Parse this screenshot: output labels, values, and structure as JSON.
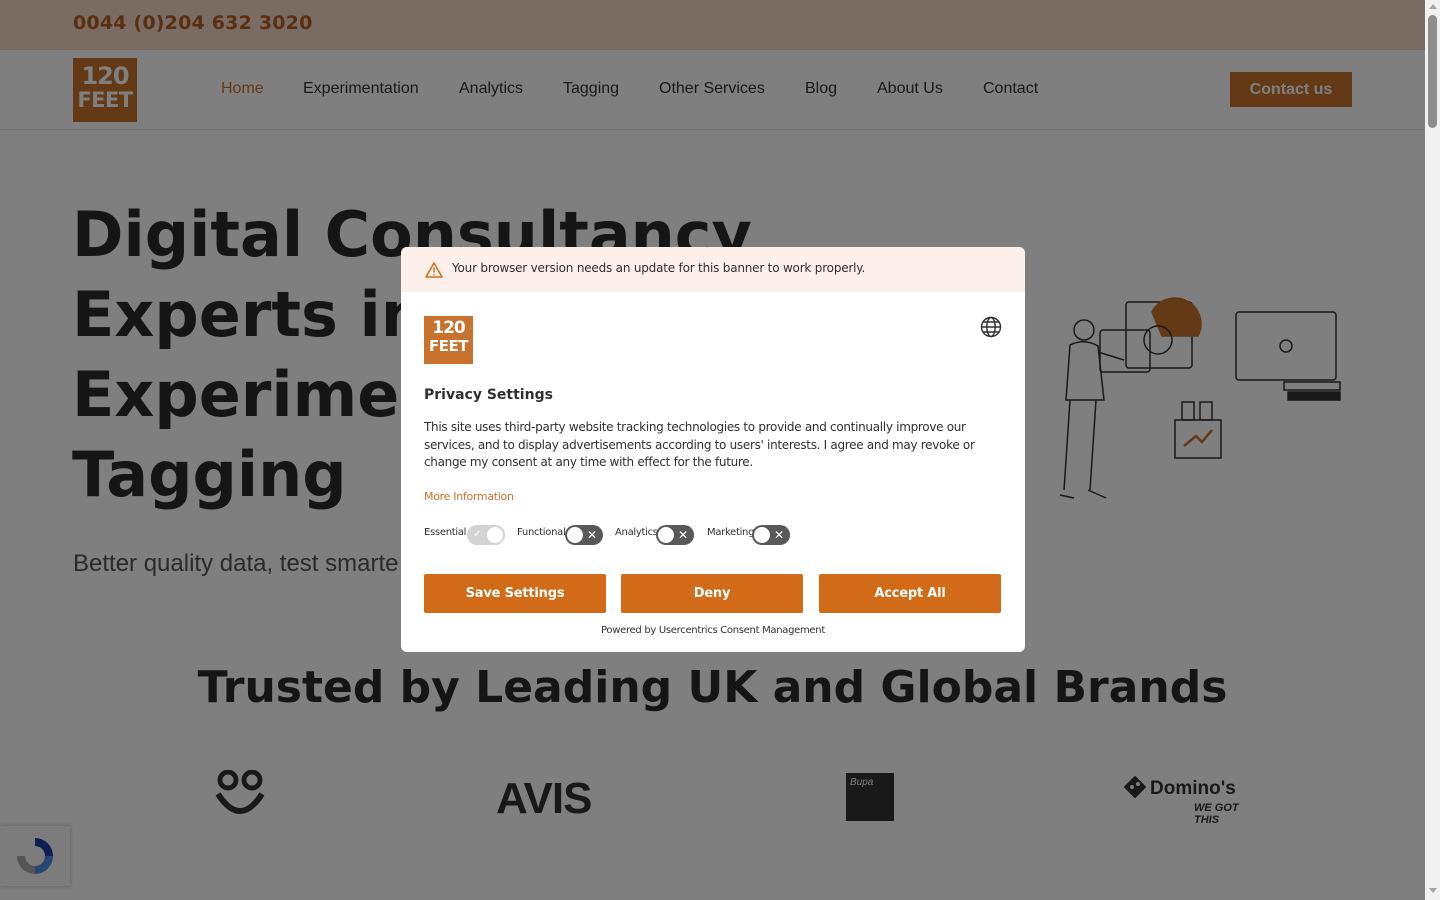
{
  "topbar": {
    "phone": "0044 (0)204 632 3020"
  },
  "header": {
    "logo_line1": "120",
    "logo_line2": "FEET",
    "nav": [
      {
        "label": "Home",
        "active": true
      },
      {
        "label": "Experimentation"
      },
      {
        "label": "Analytics"
      },
      {
        "label": "Tagging"
      },
      {
        "label": "Other Services"
      },
      {
        "label": "Blog"
      },
      {
        "label": "About Us"
      },
      {
        "label": "Contact"
      }
    ],
    "cta": "Contact us"
  },
  "hero": {
    "title_lines": [
      "Digital Consultancy",
      "Experts in",
      "Experiment",
      "Tagging"
    ],
    "subtitle": "Better quality data, test smarte"
  },
  "trusted": {
    "heading": "Trusted by Leading UK and Global Brands",
    "brands": [
      "ao",
      "AVIS",
      "Bupa",
      "Domino's"
    ],
    "avis_text": "AVIS",
    "bupa_text": "Bupa",
    "dominos_text": "Domino's",
    "dominos_tagline": "WE GOT THIS"
  },
  "consent": {
    "warning": "Your browser version needs an update for this banner to work properly.",
    "logo_line1": "120",
    "logo_line2": "FEET",
    "title": "Privacy Settings",
    "description": "This site uses third-party website tracking technologies to provide and continually improve our services, and to display advertisements according to users' interests. I agree and may revoke or change my consent at any time with effect for the future.",
    "more_info": "More Information",
    "toggles": [
      {
        "label": "Essential",
        "on": true,
        "disabled": true
      },
      {
        "label": "Functional",
        "on": false
      },
      {
        "label": "Analytics",
        "on": false
      },
      {
        "label": "Marketing",
        "on": false
      }
    ],
    "buttons": {
      "save": "Save Settings",
      "deny": "Deny",
      "accept": "Accept All"
    },
    "powered_by": "Powered by Usercentrics Consent Management"
  },
  "colors": {
    "brand": "#c8722d",
    "button": "#d26b17",
    "topbar": "#f6d8c7",
    "warning_bg": "#fdf0ea"
  }
}
